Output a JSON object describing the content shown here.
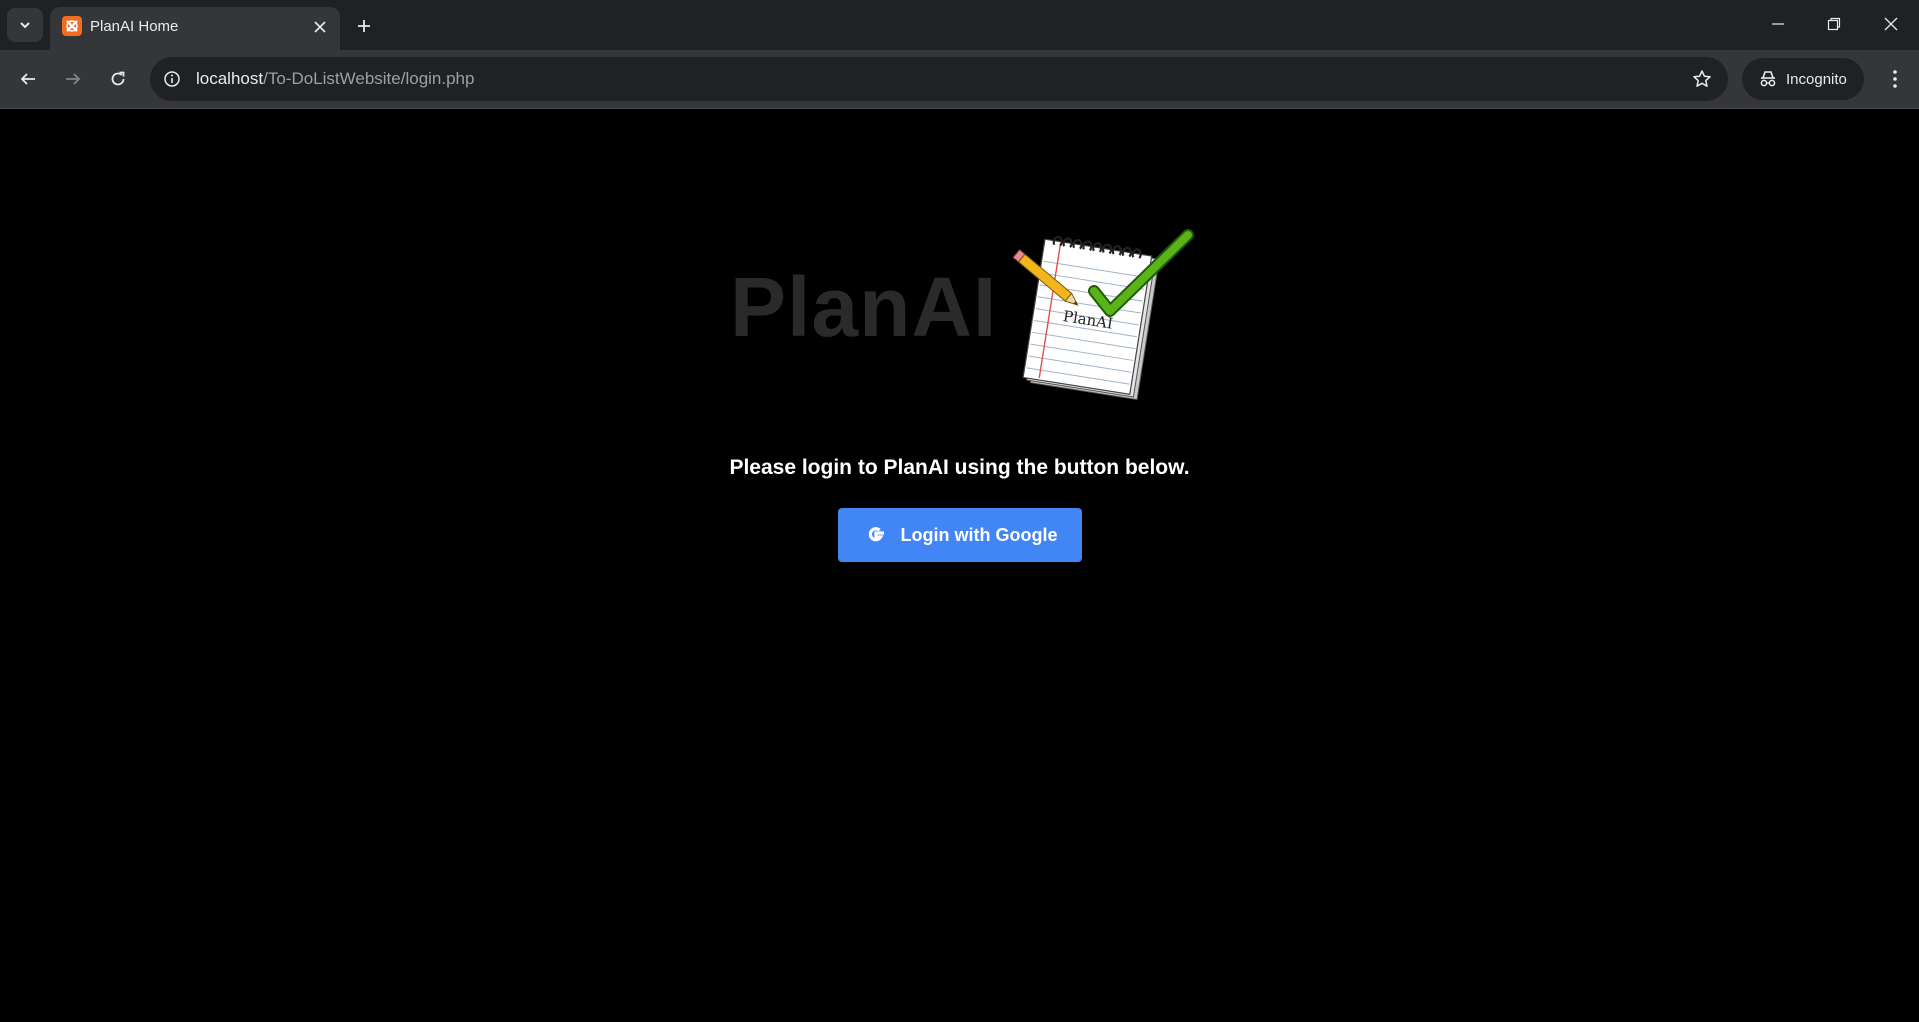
{
  "browser": {
    "tab": {
      "title": "PlanAI Home",
      "favicon": "xampp-icon"
    },
    "url": {
      "host": "localhost",
      "path": "/To-DoListWebsite/login.php"
    },
    "profile_label": "Incognito"
  },
  "page": {
    "brand_name": "PlanAI",
    "logo_notepad_text": "PlanAI",
    "prompt": "Please login to PlanAI using the button below.",
    "login_button": {
      "label": "Login with Google",
      "icon": "google-g-icon"
    }
  },
  "colors": {
    "page_background": "#000000",
    "brand_text": "#2a2a2a",
    "button": "#4285f4",
    "check_mark": "#5bb318"
  }
}
